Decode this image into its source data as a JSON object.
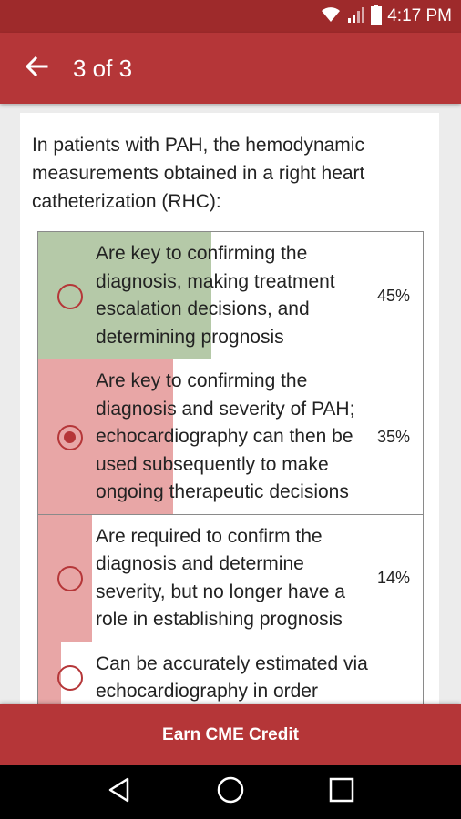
{
  "status_bar": {
    "time": "4:17 PM",
    "icons": [
      "wifi-icon",
      "signal-icon",
      "battery-icon"
    ]
  },
  "app_bar": {
    "title": "3 of 3",
    "back_icon": "arrow-left-icon"
  },
  "question": "In patients with PAH, the hemodynamic measurements obtained in a right heart catheterization (RHC):",
  "options": [
    {
      "text": "Are key to confirming the diagnosis, making treatment escalation decisions, and determining prognosis",
      "percent_label": "45%",
      "percent": 45,
      "selected": false,
      "correct": true,
      "fill_color": "#b5c9a8"
    },
    {
      "text": "Are key to confirming the diagnosis and severity of PAH; echocardiography can then be used subsequently to make ongoing therapeutic decisions",
      "percent_label": "35%",
      "percent": 35,
      "selected": true,
      "correct": false,
      "fill_color": "#e8a6a6"
    },
    {
      "text": "Are required to confirm the diagnosis and determine severity, but no longer have a role in establishing prognosis",
      "percent_label": "14%",
      "percent": 14,
      "selected": false,
      "correct": false,
      "fill_color": "#e8a6a6"
    },
    {
      "text": "Can be accurately estimated via echocardiography in order",
      "percent_label": "",
      "percent": 6,
      "selected": false,
      "correct": false,
      "fill_color": "#e8a6a6"
    }
  ],
  "cta": {
    "label": "Earn CME Credit"
  },
  "nav_bar": {
    "icons": [
      "back-triangle-icon",
      "home-circle-icon",
      "recents-square-icon"
    ]
  },
  "colors": {
    "primary": "#b53638",
    "status_bar": "#9e2a2b",
    "correct_fill": "#b5c9a8",
    "wrong_fill": "#e8a6a6"
  }
}
